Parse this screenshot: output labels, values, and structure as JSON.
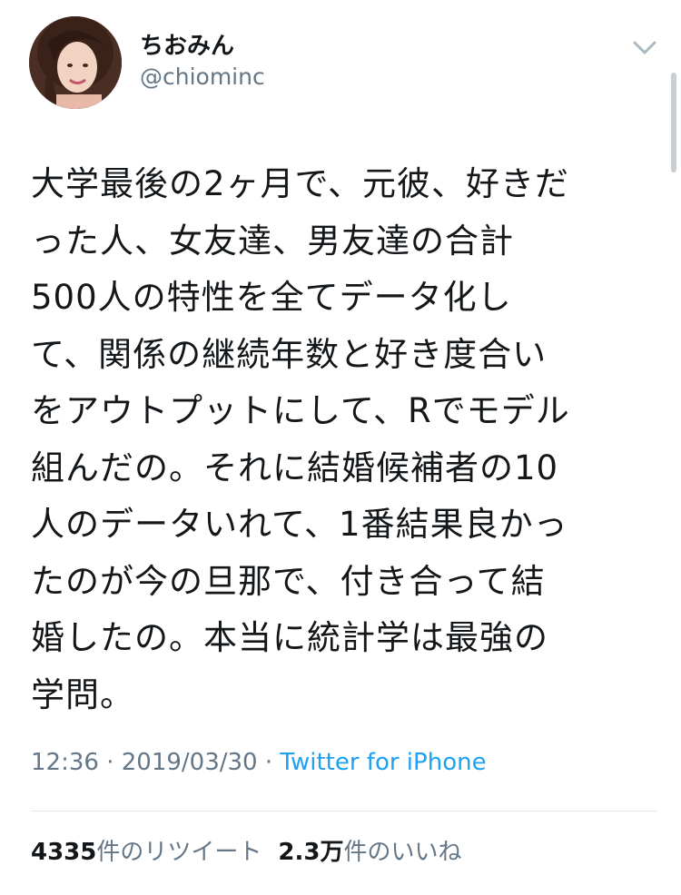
{
  "user": {
    "display_name": "ちおみん",
    "handle": "@chiominc",
    "avatar_icon": "profile-photo"
  },
  "menu": {
    "icon": "chevron-down-icon"
  },
  "tweet": {
    "lines": [
      "大学最後の2ヶ月で、元彼、好きだ",
      "った人、女友達、男友達の合計",
      "500人の特性を全てデータ化し",
      "て、関係の継続年数と好き度合い",
      "をアウトプットにして、Rでモデル",
      "組んだの。それに結婚候補者の10",
      "人のデータいれて、1番結果良かっ",
      "たのが今の旦那で、付き合って結",
      "婚したの。本当に統計学は最強の",
      "学問。"
    ],
    "time": "12:36",
    "date": "2019/03/30",
    "separator": "·",
    "source": "Twitter for iPhone"
  },
  "stats": {
    "retweets_count": "4335",
    "retweets_label": "件のリツイート",
    "likes_count": "2.3万",
    "likes_label": "件のいいね"
  },
  "colors": {
    "text": "#14171a",
    "secondary": "#657786",
    "link": "#1da1f2",
    "divider": "#e1e8ed"
  }
}
